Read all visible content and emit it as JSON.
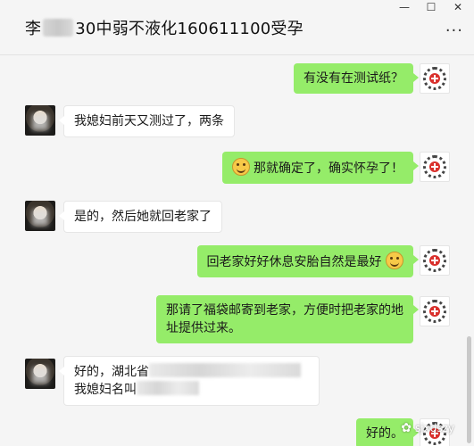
{
  "window": {
    "title_prefix": "李",
    "title_suffix": "30中弱不液化160611100受孕",
    "minimize_icon": "—",
    "maximize_icon": "☐",
    "close_icon": "✕",
    "more_icon": "···"
  },
  "messages": [
    {
      "side": "right",
      "text": "有没有在测试纸？"
    },
    {
      "side": "left",
      "text": "我媳妇前天又测过了，两条"
    },
    {
      "side": "right",
      "text": "那就确定了，确实怀孕了！",
      "emoji": "grin"
    },
    {
      "side": "left",
      "text": "是的，然后她就回老家了"
    },
    {
      "side": "right",
      "text": "回老家好好休息安胎自然是最好",
      "emoji": "smile"
    },
    {
      "side": "right",
      "line1": "那请了福袋邮寄到老家，方便时把老家的地",
      "line2": "址提供过来。"
    },
    {
      "side": "left",
      "line1": "好的，湖北省",
      "line2": "我媳妇名叫"
    },
    {
      "side": "right",
      "text": "好的。"
    }
  ],
  "watermark": {
    "icon": "wechat-icon",
    "text": "sjxdszy"
  }
}
